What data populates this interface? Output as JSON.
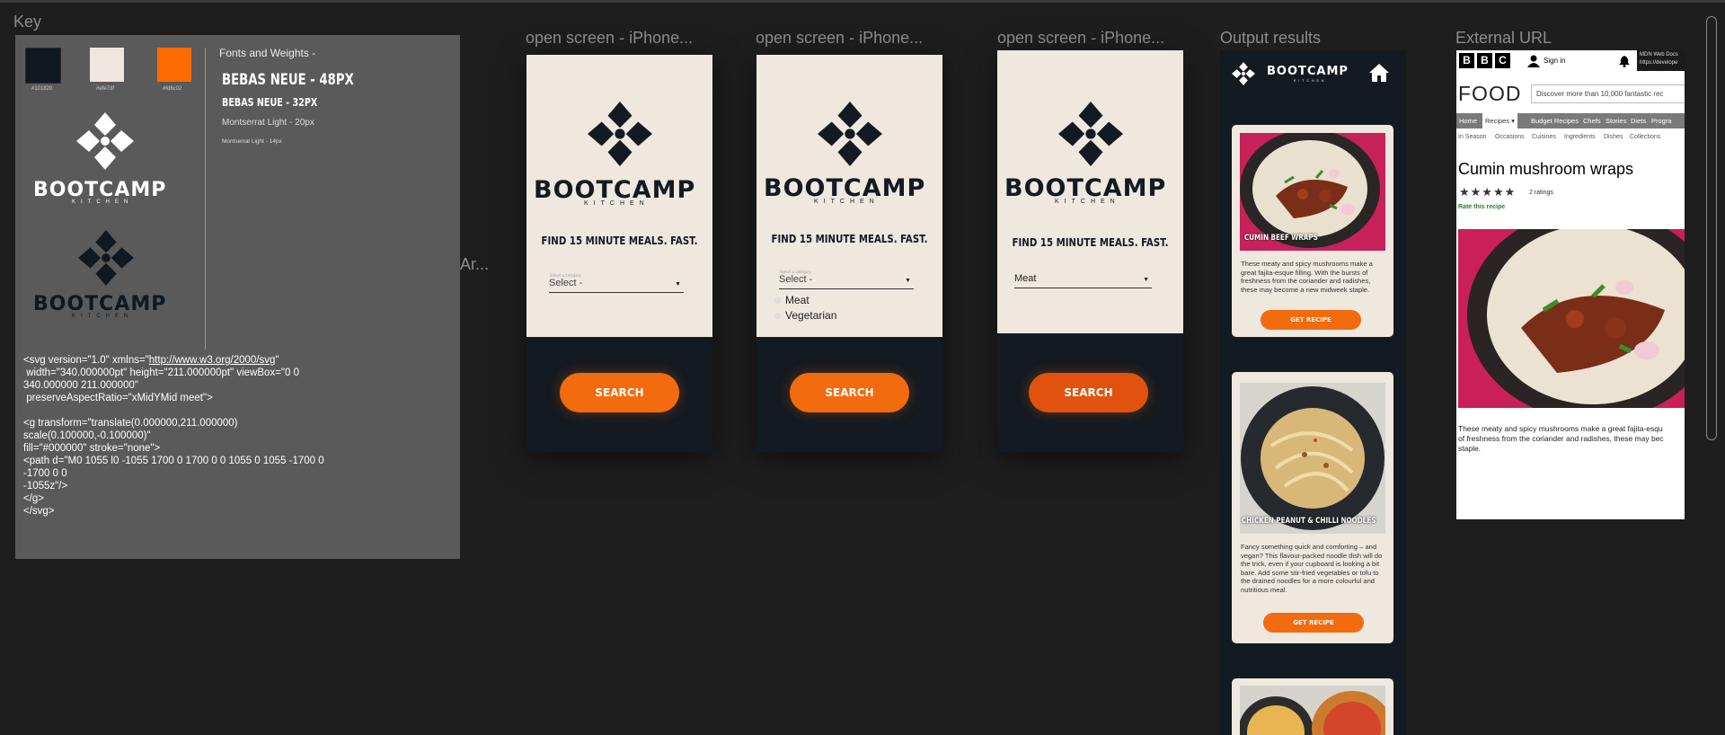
{
  "frames": {
    "key": "Key",
    "open1": "open screen - iPhone...",
    "open2": "open screen - iPhone...",
    "open3": "open screen - iPhone...",
    "output": "Output results",
    "external": "External URL",
    "arrow_fragment": "Ar..."
  },
  "key": {
    "swatches": [
      {
        "hex": "#101820",
        "label": "#101820"
      },
      {
        "hex": "#efe7df",
        "label": "#efe7df"
      },
      {
        "hex": "#fd6c02",
        "label": "#fd6c02"
      }
    ],
    "fonts_title": "Fonts and Weights -",
    "font_samples": [
      "BEBAS NEUE - 48PX",
      "BEBAS NEUE - 32PX",
      "Montserrat Light - 20px",
      "Montserrat Light - 14px"
    ],
    "svg_code_lines": [
      "<svg version=\"1.0\" xmlns=\"",
      "http://www.w3.org/2000/svg",
      "\"",
      " width=\"340.000000pt\" height=\"211.000000pt\" viewBox=\"0 0",
      "340.000000 211.000000\"",
      " preserveAspectRatio=\"xMidYMid meet\">",
      "<g transform=\"translate(0.000000,211.000000)",
      "scale(0.100000,-0.100000)\"",
      "fill=\"#000000\" stroke=\"none\">",
      "<path d=\"M0 1055 l0 -1055 1700 0 1700 0 0 1055 0 1055 -1700 0",
      "-1700 0 0",
      "-1055z\"/>",
      "</g>",
      "</svg>"
    ]
  },
  "brand": {
    "name": "BOOTCAMP",
    "sub": "KITCHEN"
  },
  "open_screen": {
    "tagline": "FIND 15 MINUTE MEALS. FAST.",
    "select_placeholder": "Select -",
    "select_tiny_label": "Select a category",
    "select_selected": "Meat",
    "options": [
      "Meat",
      "Vegetarian"
    ],
    "search_label": "SEARCH"
  },
  "output": {
    "cards": [
      {
        "title": "CUMIN BEEF WRAPS",
        "desc": "These meaty and spicy mushrooms make a great fajita-esque filling. With the bursts of freshness from the coriander and radishes, these may become a new midweek staple.",
        "button": "GET RECIPE"
      },
      {
        "title": "CHICKEN PEANUT & CHILLI NOODLES",
        "desc": "Fancy something quick and comforting – and vegan? This flavour-packed noodle dish will do the trick, even if your cupboard is looking a bit bare. Add some stir-fried vegetables or tofu to the drained noodles for a more colourful and nutritious meal.",
        "button": "GET RECIPE"
      }
    ]
  },
  "external": {
    "signin": "Sign in",
    "mdn_line1": "MDN Web Docs",
    "mdn_line2": "https://develope",
    "food_title": "FOOD",
    "search_placeholder": "Discover more than 10,000 fantastic rec",
    "nav": [
      "Home",
      "Recipes ▾",
      "Budget Recipes",
      "Chefs",
      "Stories",
      "Diets",
      "Progra"
    ],
    "subnav": [
      "In Season",
      "Occasions",
      "Cuisines",
      "Ingredients",
      "Dishes",
      "Collections"
    ],
    "recipe_title": "Cumin mushroom wraps",
    "ratings": "2 ratings",
    "rate": "Rate this recipe",
    "desc": "These meaty and spicy mushrooms make a great fajita-esque filling. With the bursts of freshness from the coriander and radishes, these may become a new midweek staple.",
    "desc_lines": [
      "These meaty and spicy mushrooms make a great fajita-esqu",
      "of freshness from the coriander and radishes, these may bec",
      "staple."
    ]
  }
}
